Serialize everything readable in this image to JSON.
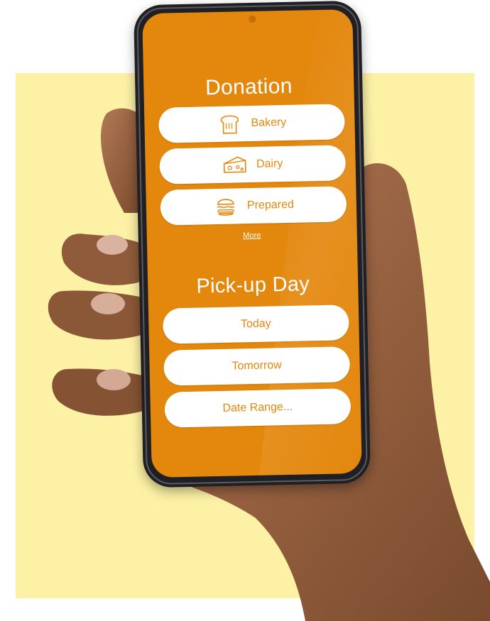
{
  "donation": {
    "title": "Donation",
    "items": [
      {
        "label": "Bakery",
        "icon": "bread-icon"
      },
      {
        "label": "Dairy",
        "icon": "cheese-icon"
      },
      {
        "label": "Prepared",
        "icon": "burger-icon"
      }
    ],
    "more_label": "More"
  },
  "pickup": {
    "title": "Pick-up Day",
    "options": [
      {
        "label": "Today"
      },
      {
        "label": "Tomorrow"
      },
      {
        "label": "Date Range..."
      }
    ]
  },
  "colors": {
    "screen": "#e3870d",
    "accent_text": "#e3870d",
    "pill": "#ffffff",
    "background_square": "#fdf1a6",
    "skin": "#9a6545"
  }
}
